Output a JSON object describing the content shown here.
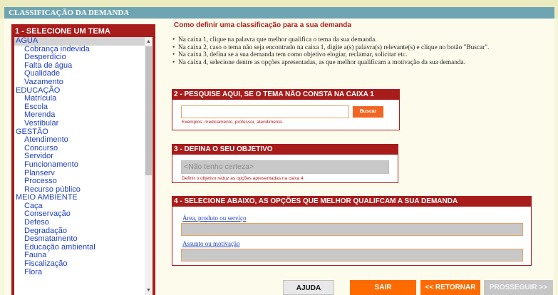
{
  "header": {
    "title": "CLASSIFICAÇÃO DA DEMANDA"
  },
  "box1": {
    "title": "1 - SELECIONE UM TEMA",
    "groups": [
      {
        "name": "AGUA",
        "items": [
          "Cobrança indevida",
          "Desperdício",
          "Falta de água",
          "Qualidade",
          "Vazamento"
        ]
      },
      {
        "name": "EDUCAÇÃO",
        "items": [
          "Matrícula",
          "Escola",
          "Merenda",
          "Vestibular"
        ]
      },
      {
        "name": "GESTÃO",
        "items": [
          "Atendimento",
          "Concurso",
          "Servidor",
          "Funcionamento",
          "Planserv",
          "Processo",
          "Recurso público"
        ]
      },
      {
        "name": "MEIO AMBIENTE",
        "items": [
          "Caça",
          "Conservação",
          "Defeso",
          "Degradação",
          "Desmatamento",
          "Educação ambiental",
          "Fauna",
          "Fiscalização",
          "Flora"
        ]
      }
    ]
  },
  "help": {
    "title": "Como definir uma classificação para a sua demanda",
    "items": [
      "Na caixa 1, clique na palavra que melhor qualifica o tema da sua demanda.",
      "Na caixa 2, caso o tema não seja encontrado na caixa 1, digite a(s) palavra(s) relevante(s) e clique no botão \"Buscar\".",
      "Na caixa 3, defina se a sua demanda tem como objetivo elogiar, reclamar, solicitar etc.",
      "Na caixa 4, selecione dentre as opções apresentadas, as que melhor qualificam a motivação da sua demanda."
    ]
  },
  "box2": {
    "title": "2 - PESQUISE AQUI, SE O TEMA NÃO CONSTA NA CAIXA 1",
    "input_value": "",
    "button": "Buscar",
    "hint": "Exemplos: medicamento, professor, atendimento."
  },
  "box3": {
    "title": "3 - DEFINA O SEU OBJETIVO",
    "selected": "<Não tenho certeza>",
    "hint": "Definir o objetivo reduz as opções apresentadas na caixa 4."
  },
  "box4": {
    "title": "4 - SELECIONE ABAIXO, AS OPÇÕES QUE MELHOR QUALIFCAM A SUA DEMANDA",
    "label1": "Área, produto ou serviço",
    "label2": "Assunto ou motivação"
  },
  "buttons": {
    "ajuda": "AJUDA",
    "sair": "SAIR",
    "retornar": "<< RETORNAR",
    "prosseguir": "PROSSEGUIR >>"
  }
}
